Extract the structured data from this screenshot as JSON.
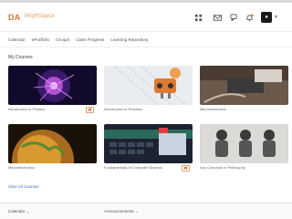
{
  "app": {
    "logo": "DA",
    "brand": "BrightSpace"
  },
  "nav": [
    "Calendar",
    "ePortfolio",
    "Groups",
    "Class Progress",
    "Learning Repository"
  ],
  "section_title": "My Courses",
  "courses": [
    {
      "title": "Introduction to Physics",
      "pinned": true,
      "theme": "plasma"
    },
    {
      "title": "Introduction to Robotics",
      "pinned": false,
      "theme": "robot"
    },
    {
      "title": "Microelectronics",
      "pinned": false,
      "theme": "circuit"
    },
    {
      "title": "Microelectronics",
      "pinned": false,
      "theme": "globe"
    },
    {
      "title": "Fundamentals of Computer Science",
      "pinned": true,
      "theme": "keyboard"
    },
    {
      "title": "Key Concepts in Philosophy",
      "pinned": false,
      "theme": "robots"
    }
  ],
  "view_all": "View All Courses",
  "footer": {
    "left_dropdown": "Calendar",
    "right_dropdown": "Announcements"
  },
  "colors": {
    "accent": "#e0723a",
    "link": "#3a6fb0"
  },
  "icons": [
    "grid-icon",
    "mail-icon",
    "chat-icon",
    "bell-icon",
    "chevron-down-icon",
    "pin-icon"
  ]
}
